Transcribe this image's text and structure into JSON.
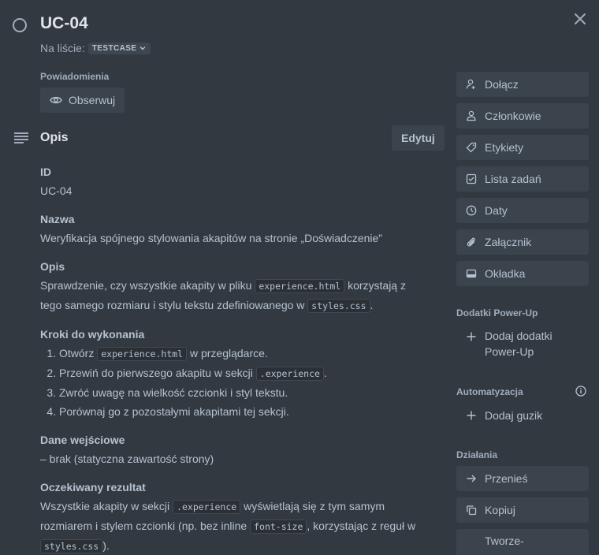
{
  "card": {
    "title": "UC-04",
    "list_prefix": "Na liście:",
    "list_name": "TESTCASE"
  },
  "notifications": {
    "label": "Powiadomienia",
    "watch_label": "Obserwuj"
  },
  "description": {
    "heading": "Opis",
    "edit_label": "Edytuj",
    "sections": {
      "id_heading": "ID",
      "id_value": "UC-04",
      "name_heading": "Nazwa",
      "name_value": "Weryfikacja spójnego stylowania akapitów na stronie „Doświadczenie”",
      "desc_heading": "Opis",
      "desc_part1": "Sprawdzenie, czy wszystkie akapity w pliku ",
      "desc_code1": "experience.html",
      "desc_part2": " korzystają z tego samego rozmiaru i stylu tekstu zdefiniowanego w ",
      "desc_code2": "styles.css",
      "desc_part3": ".",
      "steps_heading": "Kroki do wykonania",
      "step1_a": "Otwórz ",
      "step1_code": "experience.html",
      "step1_b": " w przeglądarce.",
      "step2_a": "Przewiń do pierwszego akapitu w sekcji ",
      "step2_code": ".experience",
      "step2_b": ".",
      "step3": "Zwróć uwagę na wielkość czcionki i styl tekstu.",
      "step4": "Porównaj go z pozostałymi akapitami tej sekcji.",
      "input_heading": "Dane wejściowe",
      "input_value": "– brak (statyczna zawartość strony)",
      "expected_heading": "Oczekiwany rezultat",
      "exp_part1": "Wszystkie akapity w sekcji ",
      "exp_code1": ".experience",
      "exp_part2": " wyświetlają się z tym samym rozmiarem i stylem czcionki (np. bez inline ",
      "exp_code2": "font-size",
      "exp_part3": ", korzystając z reguł w ",
      "exp_code3": "styles.css",
      "exp_part4": ")."
    }
  },
  "sidebar": {
    "add_to_card": [
      {
        "label": "Dołącz",
        "icon": "join-icon"
      },
      {
        "label": "Członkowie",
        "icon": "members-icon"
      },
      {
        "label": "Etykiety",
        "icon": "label-icon"
      },
      {
        "label": "Lista zadań",
        "icon": "checklist-icon"
      },
      {
        "label": "Daty",
        "icon": "clock-icon"
      },
      {
        "label": "Załącznik",
        "icon": "paperclip-icon"
      },
      {
        "label": "Okładka",
        "icon": "cover-icon"
      }
    ],
    "powerups_heading": "Dodatki Power-Up",
    "powerups_add": "Dodaj dodatki Power-Up",
    "automation_heading": "Automatyzacja",
    "automation_add": "Dodaj guzik",
    "actions_heading": "Działania",
    "actions": [
      {
        "label": "Przenieś",
        "icon": "arrow-right-icon"
      },
      {
        "label": "Kopiuj",
        "icon": "copy-icon"
      },
      {
        "label": "Tworze-",
        "icon": "template-icon"
      }
    ]
  }
}
